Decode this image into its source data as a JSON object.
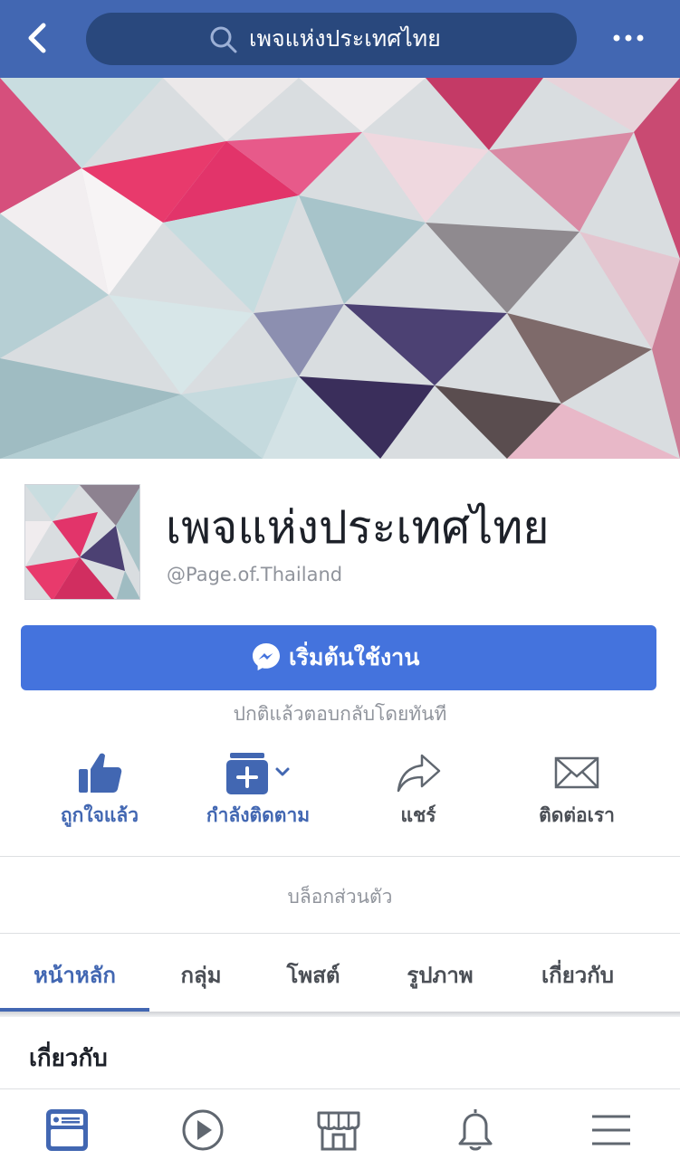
{
  "topbar": {
    "back_icon": "chevron-left-icon",
    "search_text": "เพจแห่งประเทศไทย",
    "search_icon": "search-icon",
    "more_icon": "more-dots-icon"
  },
  "profile": {
    "name": "เพจแห่งประเทศไทย",
    "handle": "@Page.of.Thailand"
  },
  "cta": {
    "label": "เริ่มต้นใช้งาน",
    "icon": "messenger-icon",
    "response_note": "ปกติแล้วตอบกลับโดยทันที"
  },
  "actions": [
    {
      "label": "ถูกใจแล้ว",
      "icon": "thumbs-up-icon",
      "color": "#4267b2"
    },
    {
      "label": "กำลังติดตาม",
      "icon": "follow-icon",
      "color": "#4267b2"
    },
    {
      "label": "แชร์",
      "icon": "share-icon",
      "color": "#4b4f56"
    },
    {
      "label": "ติดต่อเรา",
      "icon": "envelope-icon",
      "color": "#4b4f56"
    }
  ],
  "block_label": "บล็อกส่วนตัว",
  "tabs": [
    {
      "label": "หน้าหลัก",
      "active": true
    },
    {
      "label": "กลุ่ม"
    },
    {
      "label": "โพสต์"
    },
    {
      "label": "รูปภาพ"
    },
    {
      "label": "เกี่ยวกับ"
    }
  ],
  "about": {
    "title": "เกี่ยวกับ"
  },
  "bottom_nav": [
    {
      "icon": "news-feed-icon",
      "active": true
    },
    {
      "icon": "video-play-icon"
    },
    {
      "icon": "marketplace-icon"
    },
    {
      "icon": "bell-icon"
    },
    {
      "icon": "menu-icon"
    }
  ],
  "colors": {
    "brand": "#4267b2",
    "cta": "#4473dd",
    "muted": "#90949c"
  }
}
